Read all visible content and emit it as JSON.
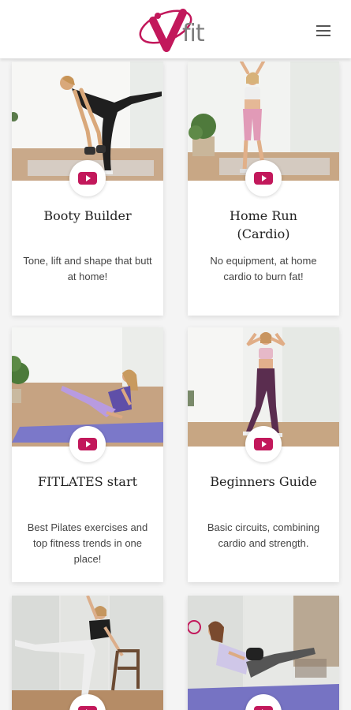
{
  "header": {
    "logo_word": "fit",
    "menu_icon": "hamburger-menu-icon",
    "brand_color": "#c2185b"
  },
  "workouts": [
    {
      "title": "Booty Builder",
      "description": "Tone, lift and shape that butt at home!",
      "play_icon": "youtube-play-icon"
    },
    {
      "title": "Home Run (Cardio)",
      "description": "No equipment, at home cardio to burn fat!",
      "play_icon": "youtube-play-icon"
    },
    {
      "title": "FITLATES start",
      "description": "Best Pilates exercises and top fitness trends in one place!",
      "play_icon": "youtube-play-icon"
    },
    {
      "title": "Beginners Guide",
      "description": "Basic circuits, combining cardio and strength.",
      "play_icon": "youtube-play-icon"
    }
  ]
}
